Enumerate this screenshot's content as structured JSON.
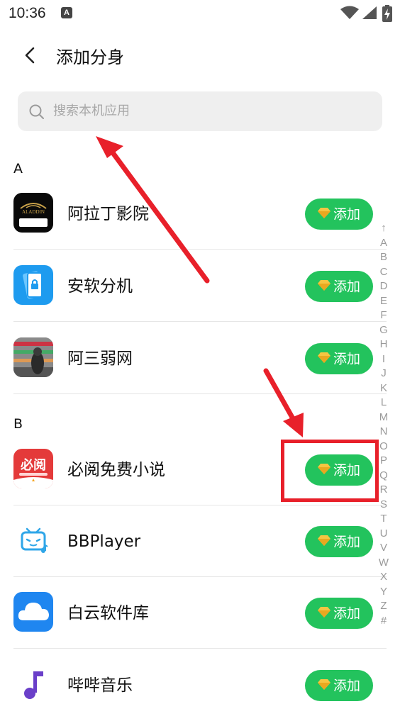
{
  "status_bar": {
    "time": "10:36",
    "notification_glyph": "A"
  },
  "header": {
    "title": "添加分身"
  },
  "search": {
    "placeholder": "搜索本机应用"
  },
  "sections": [
    {
      "letter": "A",
      "apps": [
        {
          "name": "阿拉丁影院",
          "icon": "aladdin-app-icon",
          "icon_text": "ALADDIN",
          "button": "添加"
        },
        {
          "name": "安软分机",
          "icon": "phone-lock-app-icon",
          "button": "添加"
        },
        {
          "name": "阿三弱网",
          "icon": "photo-app-icon",
          "button": "添加"
        }
      ]
    },
    {
      "letter": "B",
      "apps": [
        {
          "name": "必阅免费小说",
          "icon": "biyue-app-icon",
          "icon_text": "必阅",
          "button": "添加"
        },
        {
          "name": "BBPlayer",
          "icon": "bilibili-tv-app-icon",
          "button": "添加"
        },
        {
          "name": "白云软件库",
          "icon": "cloud-app-icon",
          "button": "添加"
        },
        {
          "name": "哔哔音乐",
          "icon": "music-note-app-icon",
          "button": "添加"
        }
      ]
    }
  ],
  "index_bar": [
    "↑",
    "A",
    "B",
    "C",
    "D",
    "E",
    "F",
    "G",
    "H",
    "I",
    "J",
    "K",
    "L",
    "M",
    "N",
    "O",
    "P",
    "Q",
    "R",
    "S",
    "T",
    "U",
    "V",
    "W",
    "X",
    "Y",
    "Z",
    "#"
  ],
  "colors": {
    "add_button": "#23c35d",
    "annotation_red": "#e8202a",
    "search_bg": "#efefef"
  }
}
